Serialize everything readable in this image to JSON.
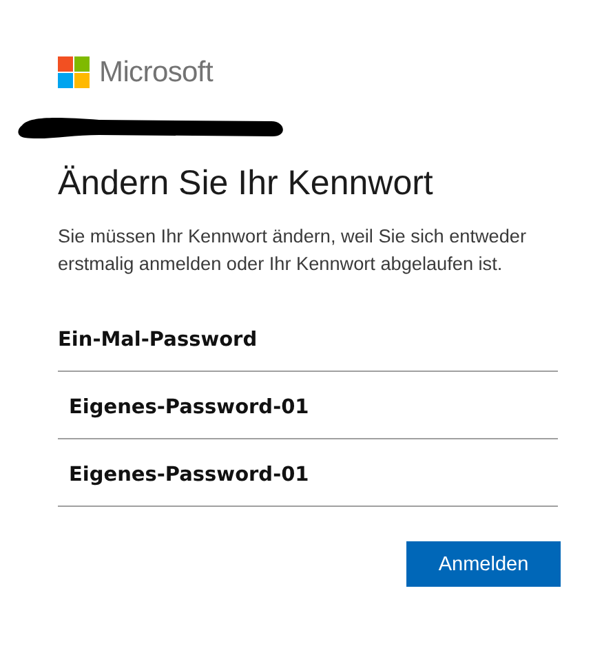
{
  "logo": {
    "text": "Microsoft"
  },
  "title": "Ändern Sie Ihr Kennwort",
  "description": "Sie müssen Ihr Kennwort ändern, weil Sie sich entweder erstmalig anmelden oder Ihr Kennwort abgelaufen ist.",
  "fields": [
    {
      "value": "Ein-Mal-Password"
    },
    {
      "value": "Eigenes-Password-01"
    },
    {
      "value": "Eigenes-Password-01"
    }
  ],
  "buttons": [
    "Anmelden"
  ]
}
